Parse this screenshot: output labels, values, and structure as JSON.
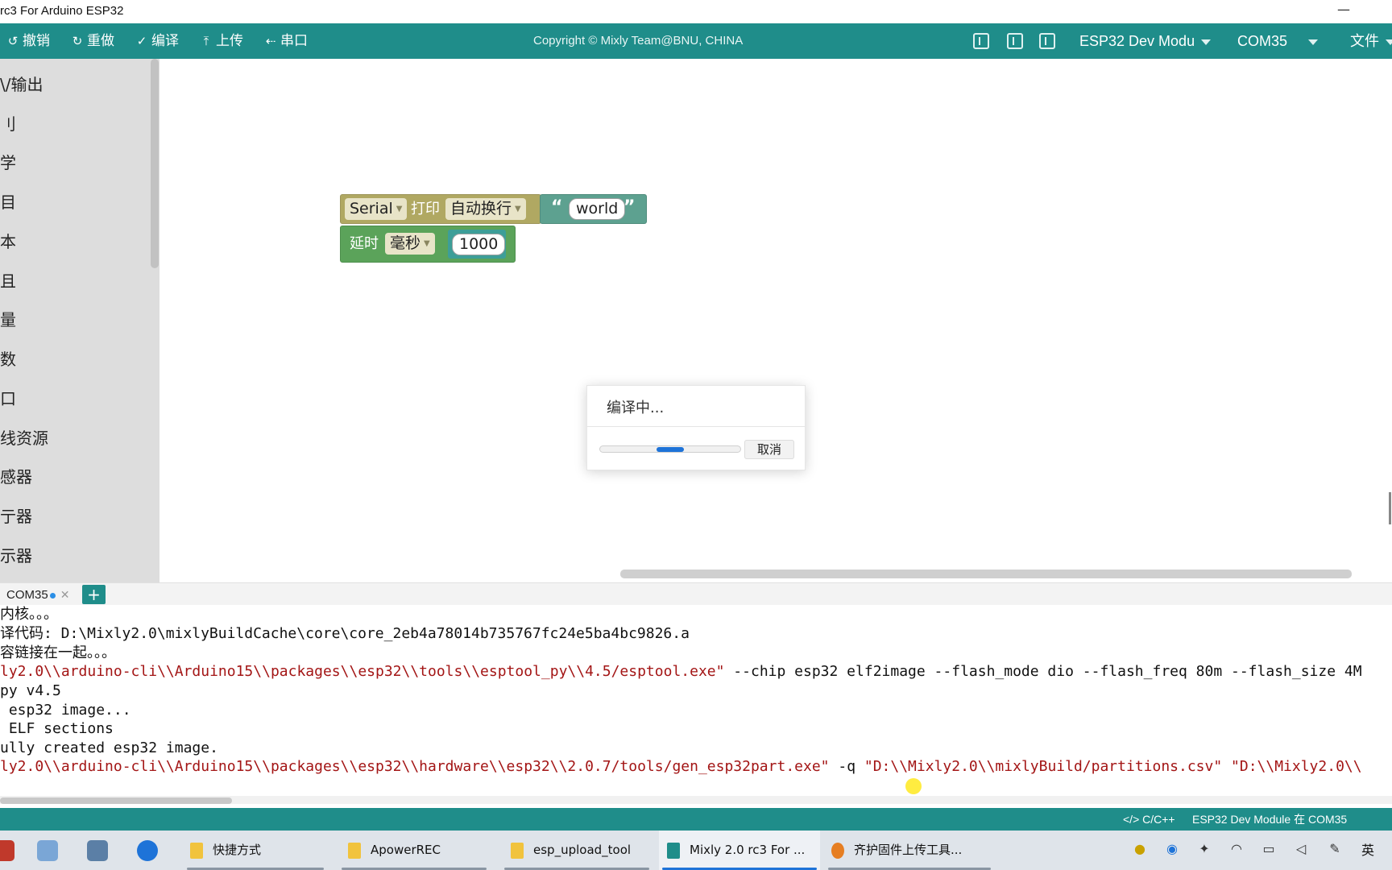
{
  "window": {
    "title": "rc3 For Arduino ESP32",
    "minimize": "—"
  },
  "toolbar": {
    "undo": "撤销",
    "redo": "重做",
    "compile": "编译",
    "upload": "上传",
    "serial": "串口",
    "copyright": "Copyright © Mixly Team@BNU, CHINA",
    "board": "ESP32 Dev Modu",
    "port": "COM35",
    "file": "文件"
  },
  "sidebar": {
    "categories": [
      "\\/输出",
      "刂",
      "学",
      "目",
      "本",
      "且",
      "量",
      "数",
      "口",
      "线资源",
      "感器",
      "亍器",
      "示器"
    ]
  },
  "blocks": {
    "serial_print": {
      "port": "Serial",
      "action": "打印",
      "mode": "自动换行",
      "text": "world"
    },
    "delay": {
      "label": "延时",
      "unit": "毫秒",
      "value": "1000"
    }
  },
  "dialog": {
    "title": "编译中...",
    "cancel": "取消"
  },
  "console": {
    "tab_name": "COM35",
    "add_tab": "+",
    "lines": [
      {
        "plain": "内核。。。"
      },
      {
        "plain": "译代码: D:\\Mixly2.0\\mixlyBuildCache\\core\\core_2eb4a78014b735767fc24e5ba4bc9826.a"
      },
      {
        "plain": "容链接在一起。。。"
      },
      {
        "str": "ly2.0\\\\arduino-cli\\\\Arduino15\\\\packages\\\\esp32\\\\tools\\\\esptool_py\\\\4.5/esptool.exe\"",
        "plain": " --chip esp32 elf2image --flash_mode dio --flash_freq 80m --flash_size 4M"
      },
      {
        "plain": "py v4.5"
      },
      {
        "plain": " esp32 image..."
      },
      {
        "plain": " ELF sections"
      },
      {
        "plain": "ully created esp32 image."
      },
      {
        "str": "ly2.0\\\\arduino-cli\\\\Arduino15\\\\packages\\\\esp32\\\\hardware\\\\esp32\\\\2.0.7/tools/gen_esp32part.exe\"",
        "plain": " -q ",
        "str2": "\"D:\\\\Mixly2.0\\\\mixlyBuild/partitions.csv\" \"D:\\\\Mixly2.0\\\\"
      }
    ]
  },
  "statusbar": {
    "language": "</> C/C++",
    "board_status": "ESP32 Dev Module 在 COM35"
  },
  "taskbar": {
    "apps": [
      "快捷方式",
      "ApowerREC",
      "esp_upload_tool",
      "Mixly 2.0 rc3 For ...",
      "齐护固件上传工具..."
    ],
    "input_lang": "英"
  },
  "progress": {
    "fill_start": 0.4,
    "fill_end": 0.6
  },
  "colors": {
    "accent": "#1f8d8a",
    "progress": "#1e73d8",
    "string": "#a31515"
  }
}
